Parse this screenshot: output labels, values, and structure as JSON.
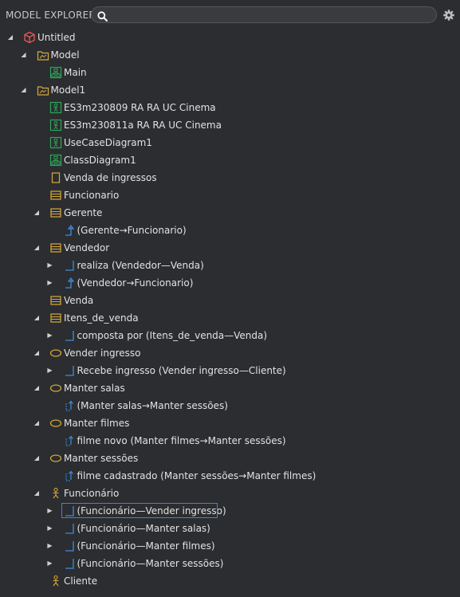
{
  "header": {
    "title": "MODEL EXPLORER",
    "search_value": ""
  },
  "icons": [
    "search-icon",
    "gear-icon"
  ],
  "colors": {
    "background": "#2b2d30",
    "project": "#e8565a",
    "model": "#d9a93a",
    "diagram": "#2fa55a",
    "classifier": "#d9a93a",
    "relation": "#3d8ddb",
    "selection": "#4a7fd6"
  },
  "tree": [
    {
      "label": "Untitled",
      "level": 0,
      "toggle": "expanded",
      "icon": "project-icon"
    },
    {
      "label": "Model",
      "level": 1,
      "toggle": "expanded",
      "icon": "model-icon"
    },
    {
      "label": "Main",
      "level": 2,
      "toggle": "none",
      "icon": "diagram-icon"
    },
    {
      "label": "Model1",
      "level": 1,
      "toggle": "expanded",
      "icon": "model-icon"
    },
    {
      "label": "ES3m230809 RA RA UC Cinema",
      "level": 2,
      "toggle": "none",
      "icon": "usecase-diagram-icon"
    },
    {
      "label": "ES3m230811a RA RA UC Cinema",
      "level": 2,
      "toggle": "none",
      "icon": "usecase-diagram-icon"
    },
    {
      "label": "UseCaseDiagram1",
      "level": 2,
      "toggle": "none",
      "icon": "usecase-diagram-icon"
    },
    {
      "label": "ClassDiagram1",
      "level": 2,
      "toggle": "none",
      "icon": "class-diagram-icon"
    },
    {
      "label": "Venda de ingressos",
      "level": 2,
      "toggle": "none",
      "icon": "subject-icon"
    },
    {
      "label": "Funcionario",
      "level": 2,
      "toggle": "none",
      "icon": "class-icon"
    },
    {
      "label": "Gerente",
      "level": 2,
      "toggle": "expanded",
      "icon": "class-icon"
    },
    {
      "label": "(Gerente→Funcionario)",
      "level": 3,
      "toggle": "none",
      "icon": "generalization-icon"
    },
    {
      "label": "Vendedor",
      "level": 2,
      "toggle": "expanded",
      "icon": "class-icon"
    },
    {
      "label": "realiza (Vendedor—Venda)",
      "level": 3,
      "toggle": "collapsed",
      "icon": "association-icon"
    },
    {
      "label": "(Vendedor→Funcionario)",
      "level": 3,
      "toggle": "collapsed",
      "icon": "generalization-icon"
    },
    {
      "label": "Venda",
      "level": 2,
      "toggle": "none",
      "icon": "class-icon"
    },
    {
      "label": "Itens_de_venda",
      "level": 2,
      "toggle": "expanded",
      "icon": "class-icon"
    },
    {
      "label": "composta por (Itens_de_venda—Venda)",
      "level": 3,
      "toggle": "collapsed",
      "icon": "association-icon"
    },
    {
      "label": "Vender ingresso",
      "level": 2,
      "toggle": "expanded",
      "icon": "usecase-icon"
    },
    {
      "label": "Recebe ingresso (Vender ingresso—Cliente)",
      "level": 3,
      "toggle": "collapsed",
      "icon": "association-icon"
    },
    {
      "label": "Manter salas",
      "level": 2,
      "toggle": "expanded",
      "icon": "usecase-icon"
    },
    {
      "label": "(Manter salas→Manter sessões)",
      "level": 3,
      "toggle": "none",
      "icon": "dependency-icon"
    },
    {
      "label": "Manter filmes",
      "level": 2,
      "toggle": "expanded",
      "icon": "usecase-icon"
    },
    {
      "label": "filme novo (Manter filmes→Manter sessões)",
      "level": 3,
      "toggle": "none",
      "icon": "dependency-icon"
    },
    {
      "label": "Manter sessões",
      "level": 2,
      "toggle": "expanded",
      "icon": "usecase-icon"
    },
    {
      "label": "filme cadastrado (Manter sessões→Manter filmes)",
      "level": 3,
      "toggle": "none",
      "icon": "dependency-icon"
    },
    {
      "label": "Funcionário",
      "level": 2,
      "toggle": "expanded",
      "icon": "actor-icon"
    },
    {
      "label": "(Funcionário—Vender ingresso)",
      "level": 3,
      "toggle": "collapsed",
      "icon": "association-icon",
      "selected": true
    },
    {
      "label": "(Funcionário—Manter salas)",
      "level": 3,
      "toggle": "collapsed",
      "icon": "association-icon"
    },
    {
      "label": "(Funcionário—Manter filmes)",
      "level": 3,
      "toggle": "collapsed",
      "icon": "association-icon"
    },
    {
      "label": "(Funcionário—Manter sessões)",
      "level": 3,
      "toggle": "collapsed",
      "icon": "association-icon"
    },
    {
      "label": "Cliente",
      "level": 2,
      "toggle": "none",
      "icon": "actor-icon"
    }
  ]
}
